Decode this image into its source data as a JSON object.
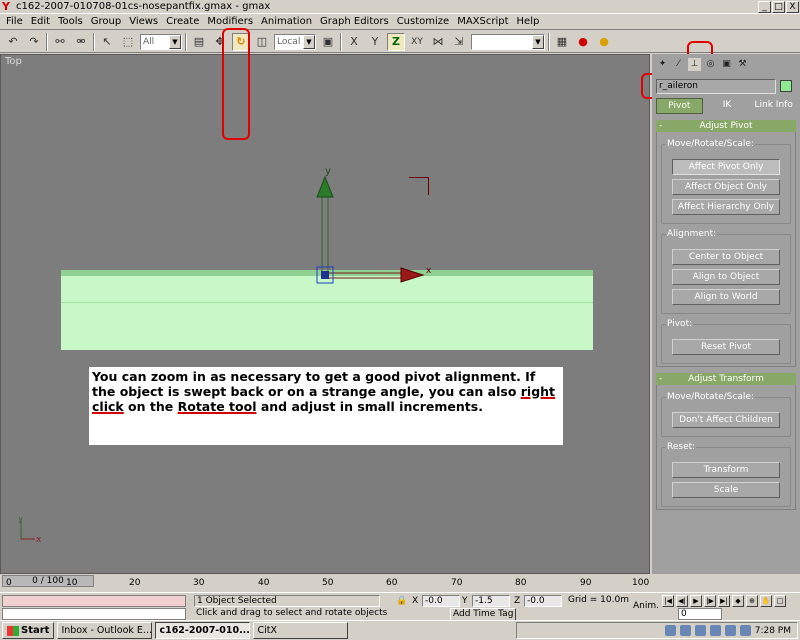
{
  "window": {
    "title": "c162-2007-010708-01cs-nosepantfix.gmax - gmax",
    "minimize": "_",
    "maximize": "□",
    "close": "X"
  },
  "menu": [
    "File",
    "Edit",
    "Tools",
    "Group",
    "Views",
    "Create",
    "Modifiers",
    "Animation",
    "Graph Editors",
    "Customize",
    "MAXScript",
    "Help"
  ],
  "toolbar": {
    "selection_filter": "All",
    "reference_coord": "Local",
    "named_selection": "",
    "axis_x": "X",
    "axis_y": "Y",
    "axis_z": "Z",
    "axis_xy": "XY"
  },
  "viewport": {
    "label": "Top",
    "gizmo_y": "y",
    "gizmo_x": "x",
    "tripod_y": "y",
    "tripod_x": "x"
  },
  "instruction": {
    "part1": "You can zoom in as necessary to get a good pivot alignment.  If the object is swept back or on a strange angle, you can also ",
    "link1": "right click",
    "part2": " on the ",
    "link2": "Rotate tool",
    "part3": " and adjust in small increments."
  },
  "command_panel": {
    "object_name": "r_aileron",
    "subtabs": [
      "Pivot",
      "IK",
      "Link Info"
    ],
    "adjust_pivot": {
      "title": "Adjust Pivot",
      "move_group": "Move/Rotate/Scale:",
      "buttons": [
        "Affect Pivot Only",
        "Affect Object Only",
        "Affect Hierarchy Only"
      ],
      "alignment_group": "Alignment:",
      "alignment_buttons": [
        "Center to Object",
        "Align to Object",
        "Align to World"
      ],
      "pivot_group": "Pivot:",
      "pivot_button": "Reset Pivot"
    },
    "adjust_transform": {
      "title": "Adjust Transform",
      "move_group": "Move/Rotate/Scale:",
      "dont_affect": "Don't Affect Children",
      "reset_group": "Reset:",
      "transform": "Transform",
      "scale": "Scale"
    }
  },
  "timeline": {
    "slider": "0 / 100",
    "ticks": [
      "0",
      "10",
      "20",
      "30",
      "40",
      "50",
      "60",
      "70",
      "80",
      "90",
      "100"
    ]
  },
  "status": {
    "selection": "1 Object Selected",
    "prompt": "Click and drag to select and rotate objects",
    "x_label": "X",
    "x_value": "-0.0",
    "y_label": "Y",
    "y_value": "-1.5",
    "z_label": "Z",
    "z_value": "-0.0",
    "grid": "Grid = 10.0m",
    "add_time_tag": "Add Time Tag",
    "anim": "Anim.",
    "frame": "0"
  },
  "taskbar": {
    "start": "Start",
    "tasks": [
      "Inbox - Outlook E...",
      "c162-2007-010...",
      "CitX"
    ],
    "clock": "7:28 PM"
  }
}
